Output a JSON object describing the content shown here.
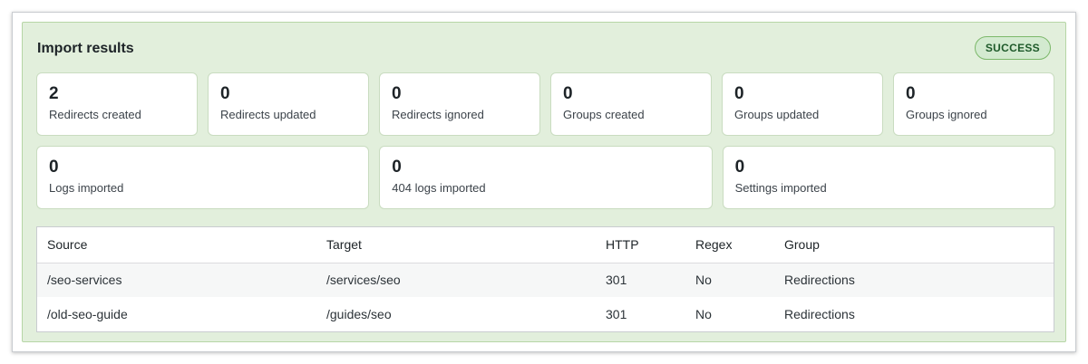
{
  "panel": {
    "title": "Import results",
    "status_badge": "SUCCESS",
    "status_color": "#1e5a2a"
  },
  "stats_row1": [
    {
      "value": "2",
      "label": "Redirects created"
    },
    {
      "value": "0",
      "label": "Redirects updated"
    },
    {
      "value": "0",
      "label": "Redirects ignored"
    },
    {
      "value": "0",
      "label": "Groups created"
    },
    {
      "value": "0",
      "label": "Groups updated"
    },
    {
      "value": "0",
      "label": "Groups ignored"
    }
  ],
  "stats_row2": [
    {
      "value": "0",
      "label": "Logs imported"
    },
    {
      "value": "0",
      "label": "404 logs imported"
    },
    {
      "value": "0",
      "label": "Settings imported"
    }
  ],
  "table": {
    "headers": [
      "Source",
      "Target",
      "HTTP",
      "Regex",
      "Group"
    ],
    "rows": [
      [
        "/seo-services",
        "/services/seo",
        "301",
        "No",
        "Redirections"
      ],
      [
        "/old-seo-guide",
        "/guides/seo",
        "301",
        "No",
        "Redirections"
      ]
    ]
  }
}
